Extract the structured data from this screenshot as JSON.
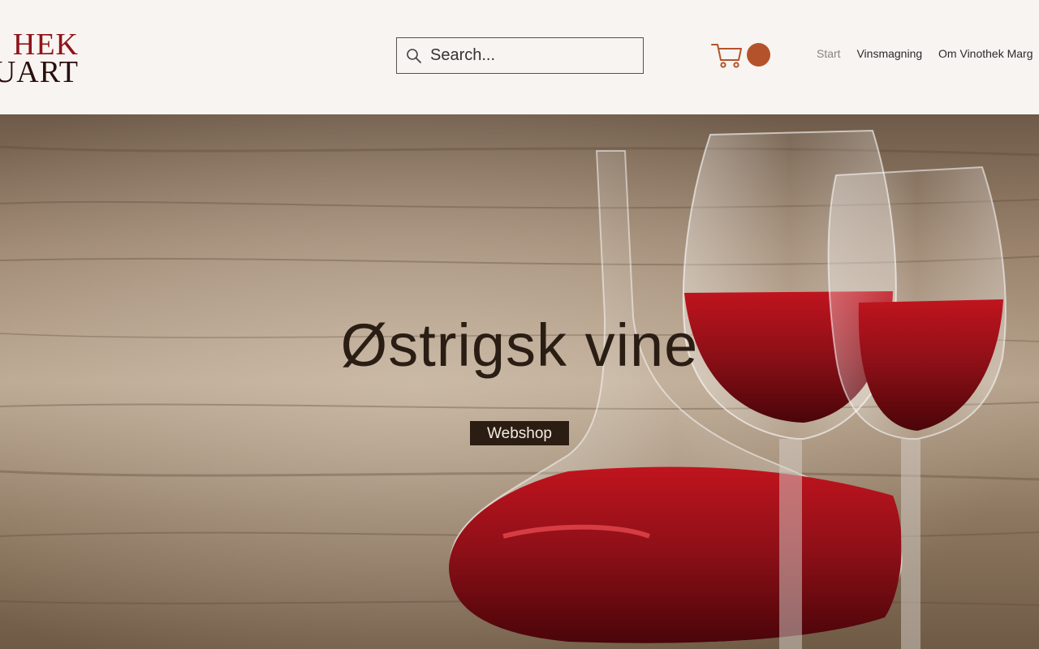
{
  "header": {
    "logo": {
      "line1": "HEK",
      "line2": "UART"
    },
    "search": {
      "placeholder": "Search..."
    },
    "cart": {
      "count": ""
    },
    "nav": {
      "items": [
        {
          "label": "Start",
          "active": true
        },
        {
          "label": "Vinsmagning",
          "active": false
        },
        {
          "label": "Om Vinothek Marg"
        }
      ]
    }
  },
  "hero": {
    "title": "Østrigsk vine",
    "button_label": "Webshop"
  },
  "colors": {
    "background": "#f7f4f1",
    "logo_red": "#8e1318",
    "accent": "#b4532b",
    "button_bg": "#2b1d12",
    "wine": "#8b0f17"
  },
  "icons": [
    "search-icon",
    "cart-icon"
  ]
}
